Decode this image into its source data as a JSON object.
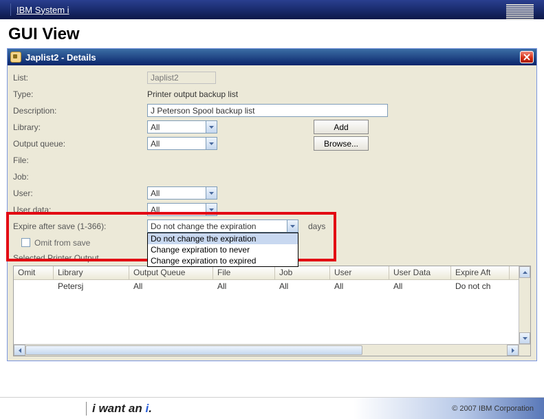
{
  "header": {
    "product": "IBM System i",
    "logo": "IBM"
  },
  "page_title": "GUI View",
  "window": {
    "title": "Japlist2 - Details",
    "close": "×"
  },
  "form": {
    "list_label": "List:",
    "list_value": "Japlist2",
    "type_label": "Type:",
    "type_value": "Printer output backup list",
    "desc_label": "Description:",
    "desc_value": "J Peterson Spool backup list",
    "library_label": "Library:",
    "library_value": "All",
    "outq_label": "Output queue:",
    "outq_value": "All",
    "file_label": "File:",
    "job_label": "Job:",
    "user_label": "User:",
    "user_value": "All",
    "userdata_label": "User data:",
    "userdata_value": "All",
    "expire_label": "Expire after save (1-366):",
    "expire_value": "Do not change the expiration",
    "days_label": "days",
    "omit_label": "Omit from save",
    "selected_label": "Selected Printer Output",
    "add_btn": "Add",
    "browse_btn": "Browse...",
    "dropdown_options": [
      "Do not change the expiration",
      "Change expiration to never",
      "Change expiration to expired"
    ]
  },
  "table": {
    "headers": [
      "Omit",
      "Library",
      "Output Queue",
      "File",
      "Job",
      "User",
      "User Data",
      "Expire Aft"
    ],
    "row": [
      "",
      "Petersj",
      "All",
      "All",
      "All",
      "All",
      "All",
      "Do not ch"
    ]
  },
  "footer": {
    "slogan_pre": "i want an ",
    "slogan_i": "i",
    "slogan_post": ".",
    "copyright": "© 2007 IBM Corporation"
  }
}
